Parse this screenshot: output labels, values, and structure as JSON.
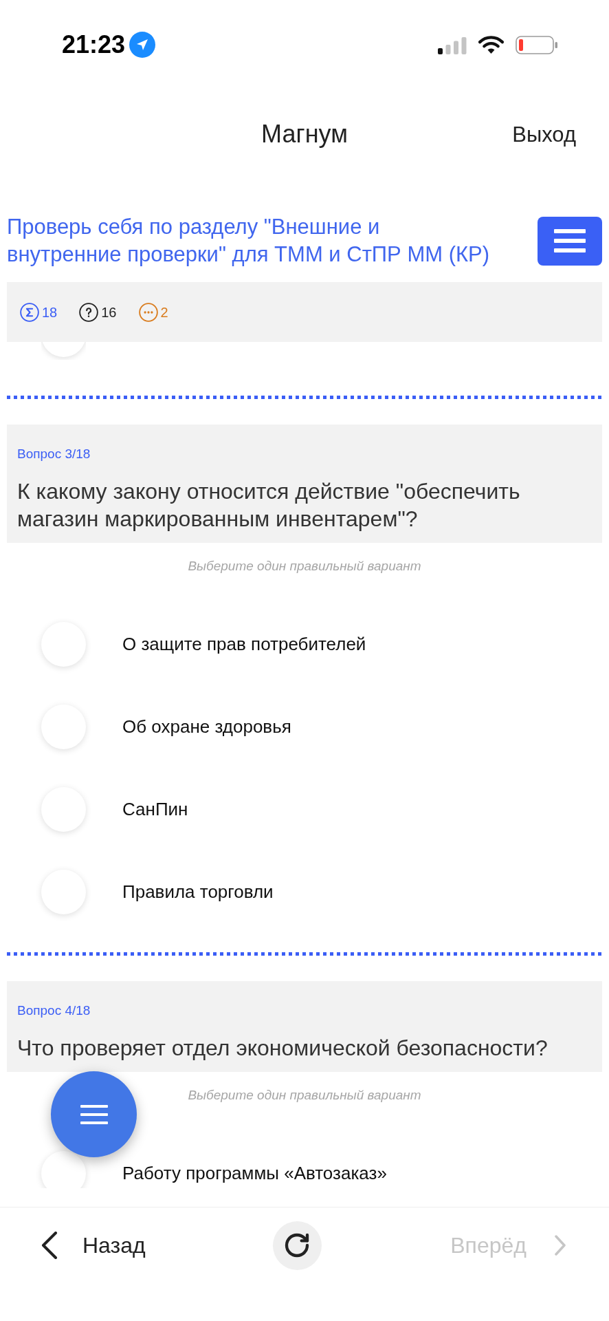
{
  "status_bar": {
    "time": "21:23"
  },
  "header": {
    "title": "Магнум",
    "action": "Выход"
  },
  "test": {
    "title": "Проверь себя по разделу \"Внешние и\nвнутренние проверки\" для ТММ и СтПР ММ (КР)"
  },
  "stats": [
    {
      "kind": "sigma",
      "count": "18",
      "color": "#3b5ef5"
    },
    {
      "kind": "question",
      "count": "16",
      "color": "#222222"
    },
    {
      "kind": "dots",
      "count": "2",
      "color": "#d97c1e"
    }
  ],
  "scrolled_option": {
    "selected": false
  },
  "questions": [
    {
      "number": "Вопрос 3/18",
      "text": "К какому закону относится действие \"обеспечить магазин маркированным инвентарем\"?",
      "hint": "Выберите один правильный вариант",
      "options": [
        {
          "label": "О защите прав потребителей",
          "selected": false
        },
        {
          "label": "Об охране здоровья",
          "selected": false
        },
        {
          "label": "СанПин",
          "selected": false
        },
        {
          "label": "Правила торговли",
          "selected": false
        }
      ]
    },
    {
      "number": "Вопрос 4/18",
      "text": "Что проверяет отдел экономической безопасности?",
      "hint": "Выберите один правильный вариант",
      "options": [
        {
          "label": "Работу программы «Автозаказ»",
          "selected": false
        }
      ]
    }
  ],
  "bottom_nav": {
    "back": {
      "label": "Назад",
      "disabled": false
    },
    "forward": {
      "label": "Вперёд",
      "disabled": true
    }
  }
}
